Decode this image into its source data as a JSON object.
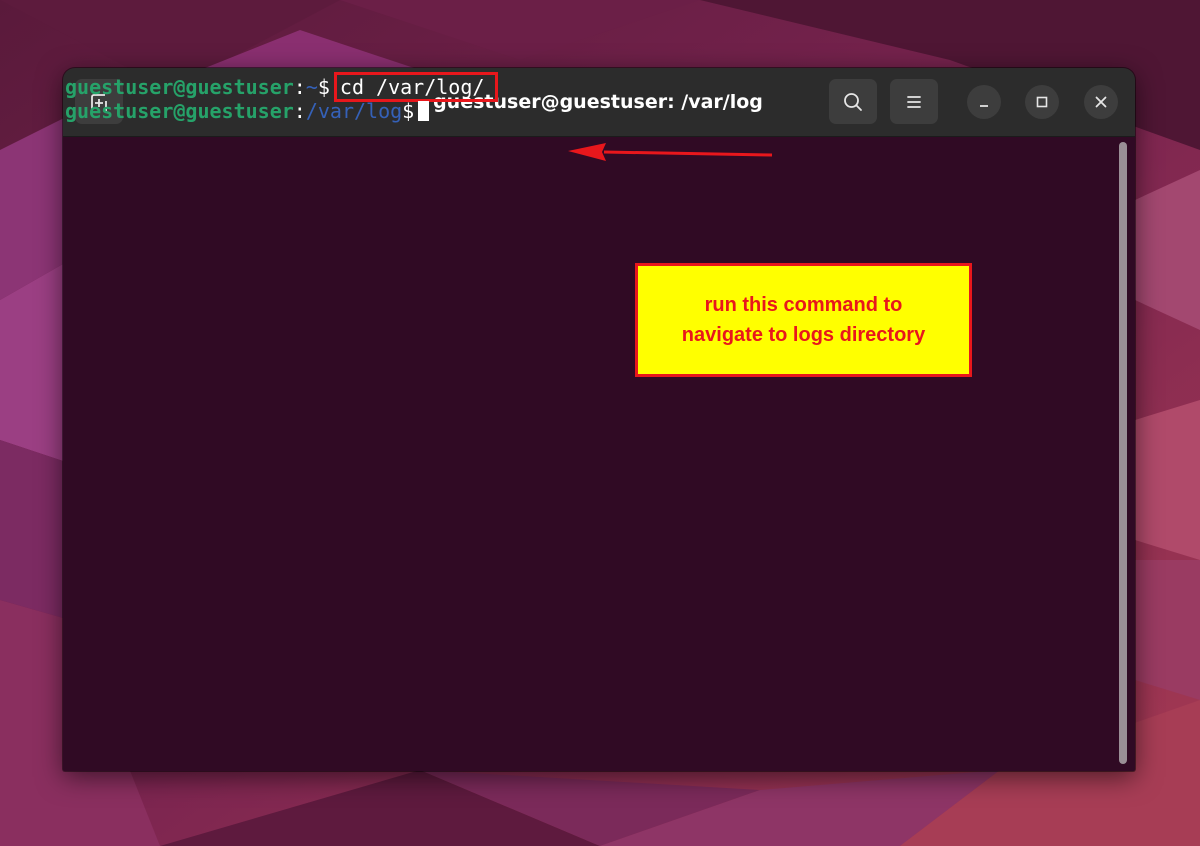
{
  "window": {
    "title": "guestuser@guestuser: /var/log",
    "buttons": {
      "new_tab": "new-tab-icon",
      "search": "search-icon",
      "menu": "hamburger-menu-icon",
      "minimize": "minimize-icon",
      "maximize": "maximize-icon",
      "close": "close-icon"
    }
  },
  "terminal": {
    "line1": {
      "user_host": "guestuser@guestuser",
      "colon": ":",
      "path": "~",
      "prompt": "$",
      "command": "cd /var/log/"
    },
    "line2": {
      "user_host": "guestuser@guestuser",
      "colon": ":",
      "path": "/var/log",
      "prompt": "$"
    }
  },
  "annotation": {
    "line1": "run this command to",
    "line2": "navigate to logs directory"
  },
  "colors": {
    "terminal_bg": "#300a24",
    "titlebar_bg": "#2c2c2c",
    "user_green": "#26a269",
    "path_blue": "#3561b8",
    "annotation_red": "#e8171c",
    "annotation_yellow": "#ffff00"
  }
}
